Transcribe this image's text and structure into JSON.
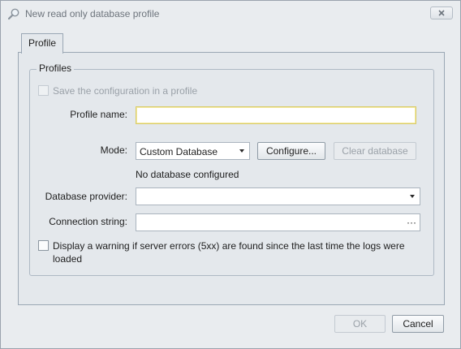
{
  "window": {
    "title": "New read only database profile",
    "title_icon": "magnifier-icon",
    "close_icon": "close-icon"
  },
  "tabs": [
    {
      "label": "Profile",
      "selected": true
    }
  ],
  "profiles_group": {
    "label": "Profiles",
    "save_checkbox": {
      "label": "Save the configuration in a profile",
      "checked": false,
      "enabled": false
    },
    "profile_name": {
      "label": "Profile name:",
      "value": ""
    },
    "mode": {
      "label": "Mode:",
      "selected": "Custom Database",
      "configure_label": "Configure...",
      "clear_label": "Clear database",
      "status": "No database configured"
    },
    "database_provider": {
      "label": "Database provider:",
      "value": ""
    },
    "connection_string": {
      "label": "Connection string:",
      "value": "",
      "browse_label": "···"
    },
    "warning_checkbox": {
      "line1": "Display a warning if server errors (5xx) are found since the last time the logs were",
      "line2": "loaded",
      "checked": false
    }
  },
  "footer": {
    "ok_label": "OK",
    "cancel_label": "Cancel"
  },
  "colors": {
    "background": "#e9ecef",
    "border": "#9aa7b4",
    "focus": "#d9cc6a",
    "disabled_text": "#9aa1a8"
  }
}
